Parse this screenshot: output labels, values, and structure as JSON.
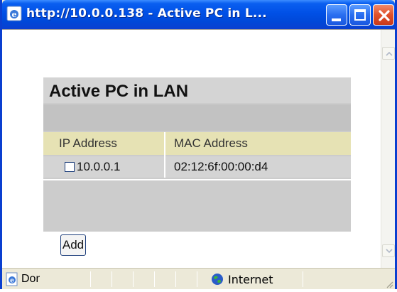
{
  "window": {
    "title": "http://10.0.0.138 - Active PC in L..."
  },
  "page": {
    "heading": "Active PC in LAN",
    "table": {
      "columns": [
        "IP Address",
        "MAC Address"
      ],
      "rows": [
        {
          "ip": "10.0.0.1",
          "mac": "02:12:6f:00:00:d4",
          "checked": false
        }
      ]
    },
    "add_label": "Add"
  },
  "statusbar": {
    "status": "Done",
    "zone": "Internet"
  },
  "colors": {
    "titlebar": "#0050e6",
    "panel": "#cccccc",
    "header_row": "#e6e2b4",
    "close_button": "#e0502a"
  },
  "icons": [
    "ie-icon",
    "minimize-icon",
    "maximize-icon",
    "close-icon",
    "scroll-up-icon",
    "scroll-down-icon",
    "page-done-icon",
    "internet-zone-icon",
    "resize-grip-icon"
  ]
}
